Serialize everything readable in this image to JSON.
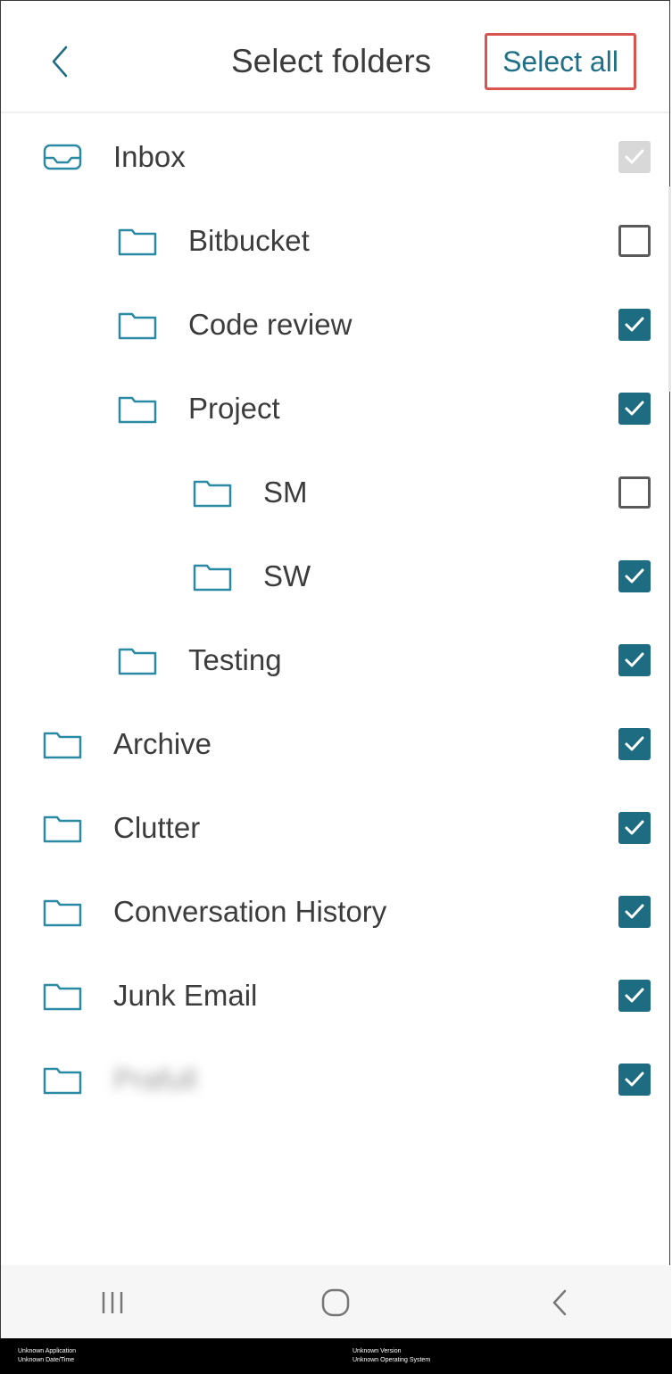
{
  "header": {
    "title": "Select folders",
    "select_all_label": "Select all"
  },
  "folders": [
    {
      "label": "Inbox",
      "icon": "inbox-icon",
      "level": 0,
      "state": "disabled-checked"
    },
    {
      "label": "Bitbucket",
      "icon": "folder-icon",
      "level": 1,
      "state": "unchecked"
    },
    {
      "label": "Code review",
      "icon": "folder-icon",
      "level": 1,
      "state": "checked"
    },
    {
      "label": "Project",
      "icon": "folder-icon",
      "level": 1,
      "state": "checked"
    },
    {
      "label": "SM",
      "icon": "folder-icon",
      "level": 2,
      "state": "unchecked"
    },
    {
      "label": "SW",
      "icon": "folder-icon",
      "level": 2,
      "state": "checked"
    },
    {
      "label": "Testing",
      "icon": "folder-icon",
      "level": 1,
      "state": "checked"
    },
    {
      "label": "Archive",
      "icon": "folder-icon",
      "level": 0,
      "state": "checked"
    },
    {
      "label": "Clutter",
      "icon": "folder-icon",
      "level": 0,
      "state": "checked"
    },
    {
      "label": "Conversation History",
      "icon": "folder-icon",
      "level": 0,
      "state": "checked"
    },
    {
      "label": "Junk Email",
      "icon": "folder-icon",
      "level": 0,
      "state": "checked"
    },
    {
      "label": "Prafull",
      "icon": "folder-icon",
      "level": 0,
      "state": "checked",
      "blurred": true
    }
  ],
  "navbar": {
    "items": [
      "recent-apps-icon",
      "home-icon",
      "back-icon"
    ]
  },
  "footer": {
    "left_line1": "Unknown Application",
    "left_line2": "Unknown Date/Time",
    "right_line1": "Unknown Version",
    "right_line2": "Unknown Operating System"
  },
  "colors": {
    "accent": "#1d6c82",
    "highlight_border": "#d9534f"
  }
}
